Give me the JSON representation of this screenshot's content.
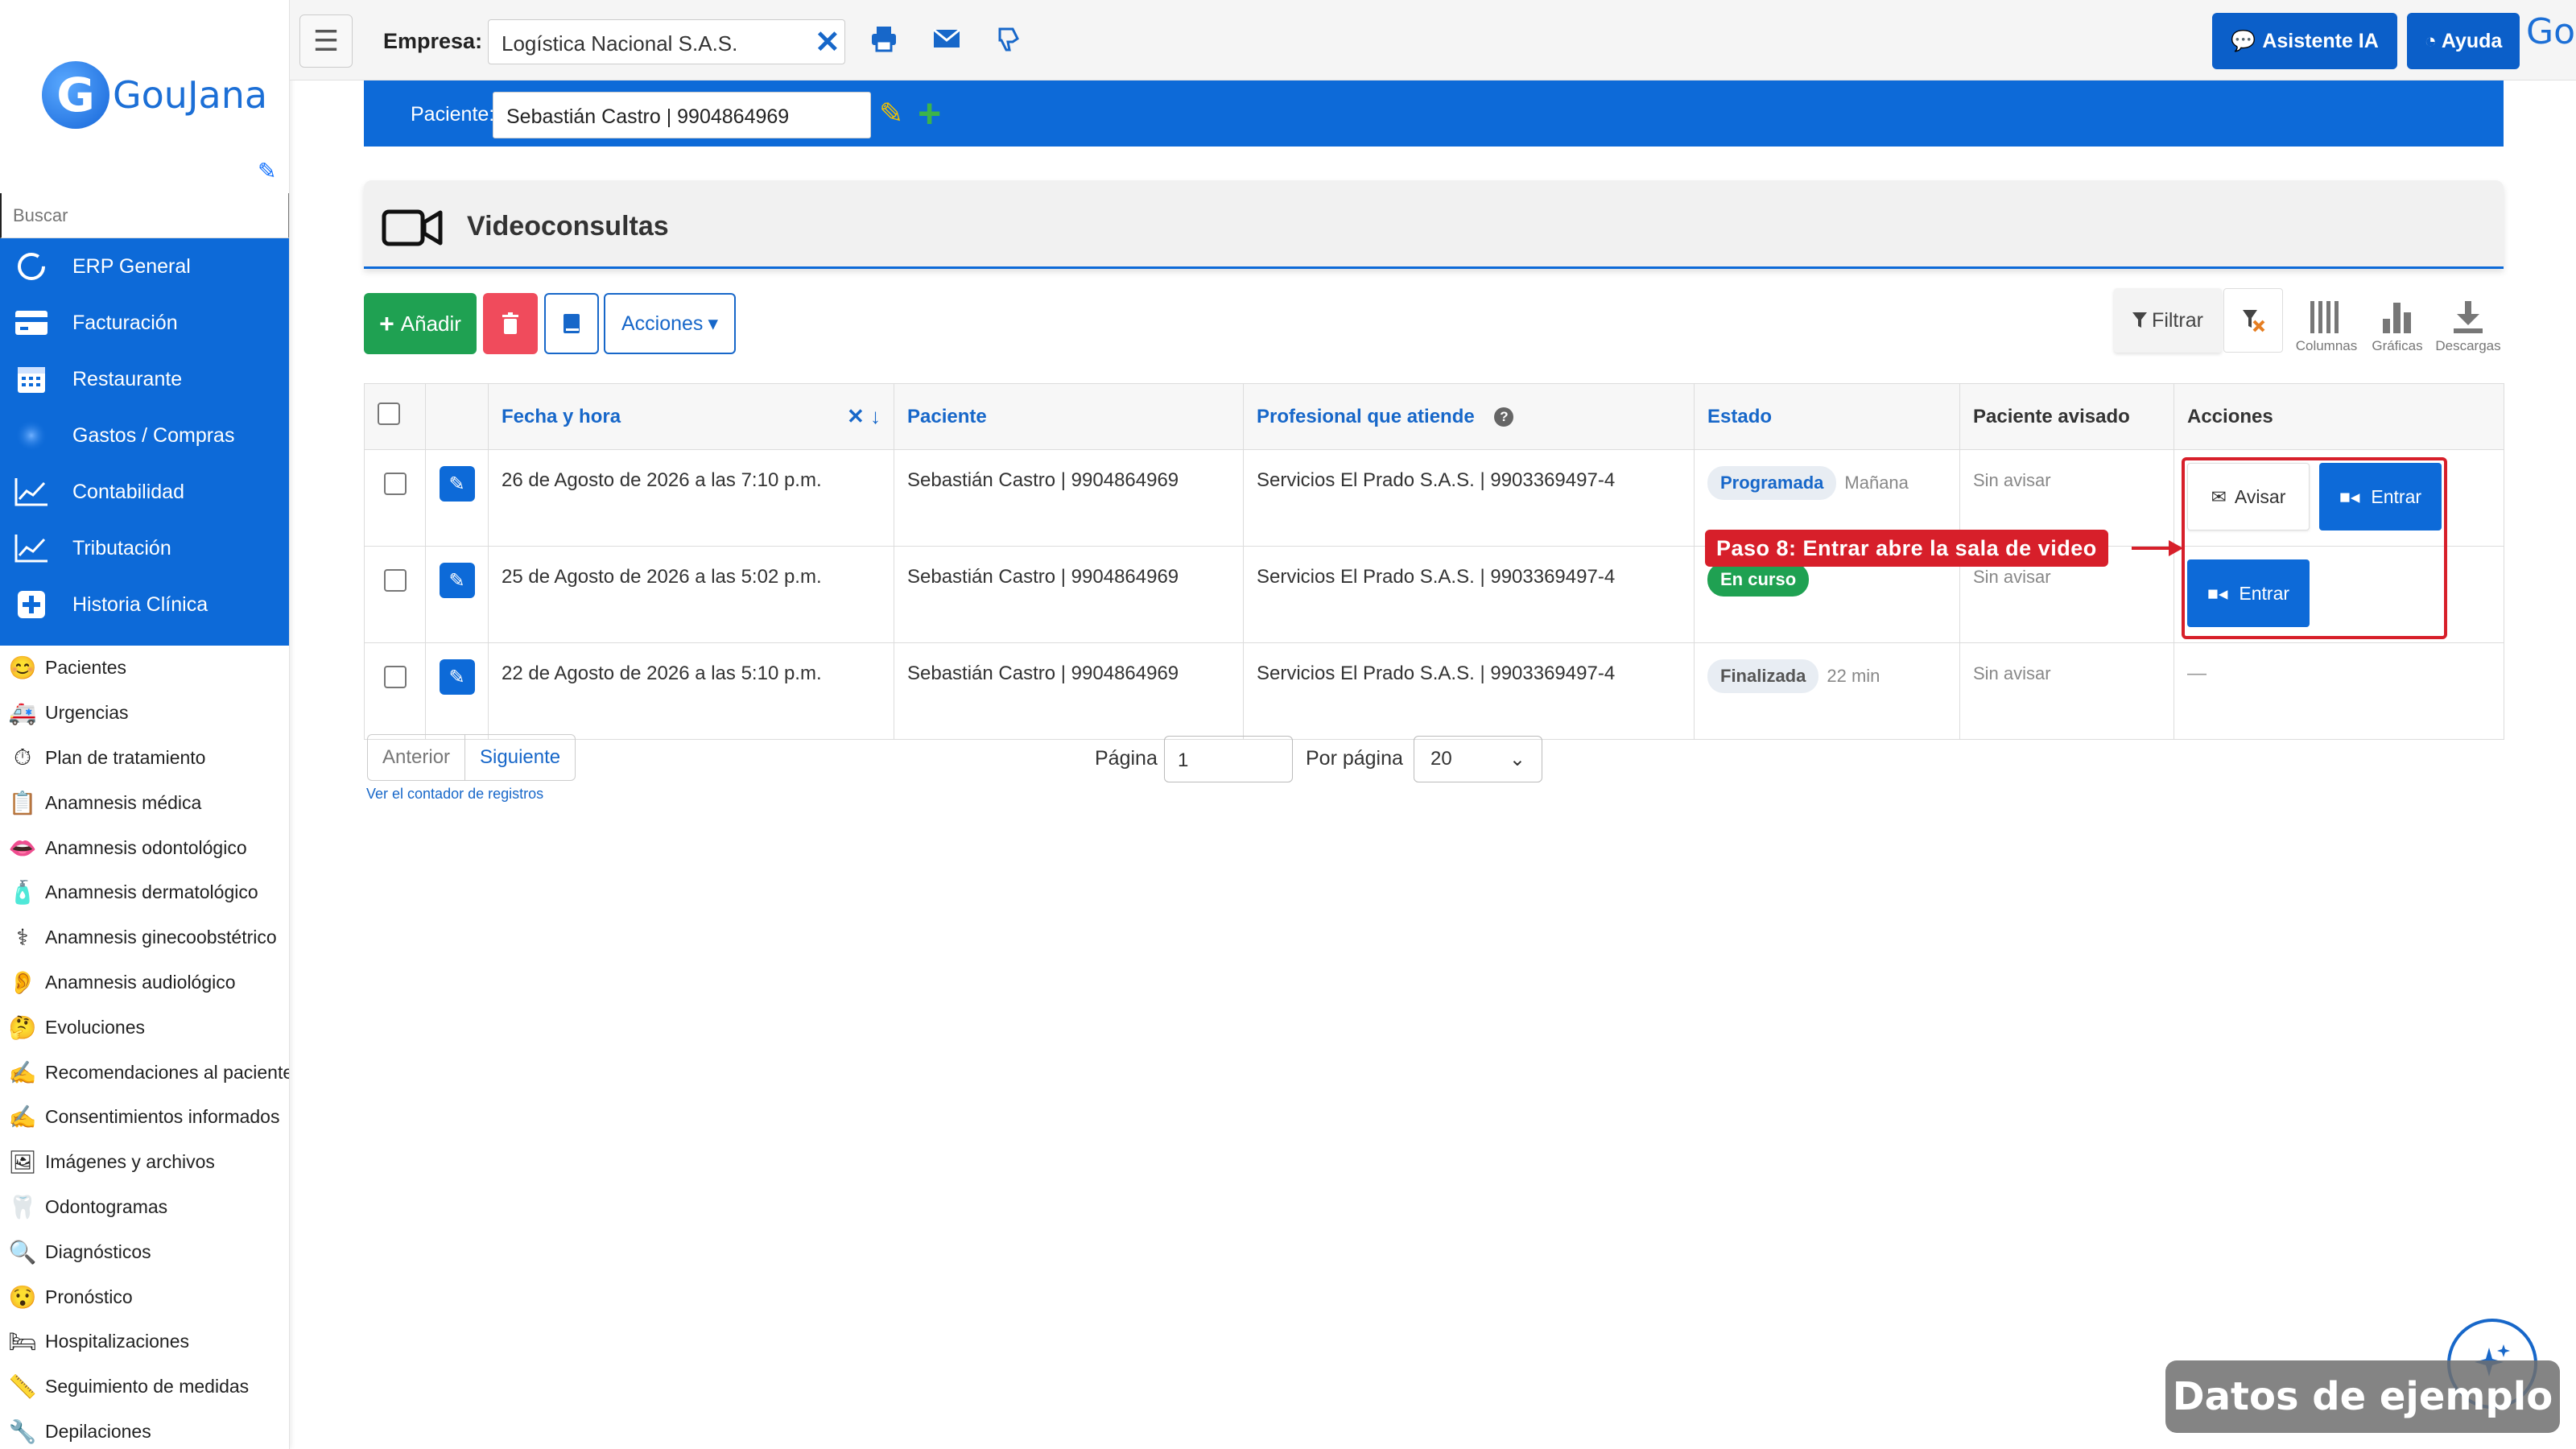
{
  "brand": {
    "logo_letter": "G",
    "logo_text": "GouJana"
  },
  "sidebar": {
    "search_placeholder": "Buscar",
    "erp_items": [
      {
        "label": "ERP General",
        "icon": "circle-icon"
      },
      {
        "label": "Facturación",
        "icon": "card-icon"
      },
      {
        "label": "Restaurante",
        "icon": "calendar-icon"
      },
      {
        "label": "Gastos / Compras",
        "icon": "blur-circle-icon"
      },
      {
        "label": "Contabilidad",
        "icon": "chart-line-icon"
      },
      {
        "label": "Tributación",
        "icon": "chart-line-icon"
      },
      {
        "label": "Historia Clínica",
        "icon": "plus-square-icon"
      }
    ],
    "hc_items": [
      {
        "label": "Pacientes",
        "icon": "😊"
      },
      {
        "label": "Urgencias",
        "icon": "🚑"
      },
      {
        "label": "Plan de tratamiento",
        "icon": "⏱"
      },
      {
        "label": "Anamnesis médica",
        "icon": "📋"
      },
      {
        "label": "Anamnesis odontológico",
        "icon": "👄"
      },
      {
        "label": "Anamnesis dermatológico",
        "icon": "🧴"
      },
      {
        "label": "Anamnesis ginecoobstétrico",
        "icon": "⚕"
      },
      {
        "label": "Anamnesis audiológico",
        "icon": "👂"
      },
      {
        "label": "Evoluciones",
        "icon": "🤔"
      },
      {
        "label": "Recomendaciones al paciente",
        "icon": "✍"
      },
      {
        "label": "Consentimientos informados",
        "icon": "✍"
      },
      {
        "label": "Imágenes y archivos",
        "icon": "🖼"
      },
      {
        "label": "Odontogramas",
        "icon": "🦷"
      },
      {
        "label": "Diagnósticos",
        "icon": "🔍"
      },
      {
        "label": "Pronóstico",
        "icon": "😯"
      },
      {
        "label": "Hospitalizaciones",
        "icon": "🛏"
      },
      {
        "label": "Seguimiento de medidas",
        "icon": "📏"
      },
      {
        "label": "Depilaciones",
        "icon": "🔧"
      }
    ]
  },
  "topbar": {
    "empresa_label": "Empresa:",
    "empresa_value": "Logística Nacional S.A.S.",
    "asistente_label": "Asistente IA",
    "ayuda_label": "Ayuda",
    "avatar_text": "Gou"
  },
  "patient": {
    "label": "Paciente:",
    "value": "Sebastián Castro | 9904864969"
  },
  "page": {
    "title": "Videoconsultas"
  },
  "toolbar": {
    "add_label": "Añadir",
    "acciones_label": "Acciones",
    "filtrar_label": "Filtrar",
    "columnas_label": "Columnas",
    "graficas_label": "Gráficas",
    "descargas_label": "Descargas"
  },
  "table": {
    "headers": {
      "fecha": "Fecha y hora",
      "paciente": "Paciente",
      "profesional": "Profesional que atiende",
      "estado": "Estado",
      "avisado": "Paciente avisado",
      "acciones": "Acciones"
    },
    "rows": [
      {
        "fecha": "26 de Agosto de 2026 a las 7:10 p.m.",
        "paciente": "Sebastián Castro | 9904864969",
        "profesional": "Servicios El Prado S.A.S. | 9903369497-4",
        "estado": "Programada",
        "estado_extra": "Mañana",
        "avisado": "Sin avisar",
        "avisar_label": "Avisar",
        "entrar_label": "Entrar"
      },
      {
        "fecha": "25 de Agosto de 2026 a las 5:02 p.m.",
        "paciente": "Sebastián Castro | 9904864969",
        "profesional": "Servicios El Prado S.A.S. | 9903369497-4",
        "estado": "En curso",
        "estado_extra": "",
        "avisado": "Sin avisar",
        "entrar_label": "Entrar"
      },
      {
        "fecha": "22 de Agosto de 2026 a las 5:10 p.m.",
        "paciente": "Sebastián Castro | 9904864969",
        "profesional": "Servicios El Prado S.A.S. | 9903369497-4",
        "estado": "Finalizada",
        "estado_extra": "22 min",
        "avisado": "Sin avisar",
        "acciones_text": "—"
      }
    ]
  },
  "annotation": {
    "callout": "Paso 8: Entrar abre la sala de video",
    "color": "#d71f2a"
  },
  "pagination": {
    "prev_label": "Anterior",
    "next_label": "Siguiente",
    "counter_link": "Ver el contador de registros",
    "pagina_label": "Página",
    "pagina_value": "1",
    "porpagina_label": "Por página",
    "porpagina_value": "20"
  },
  "watermark": "Datos de ejemplo",
  "colors": {
    "primary": "#0d6ad8",
    "success": "#1fa152",
    "danger": "#f04b5c"
  }
}
